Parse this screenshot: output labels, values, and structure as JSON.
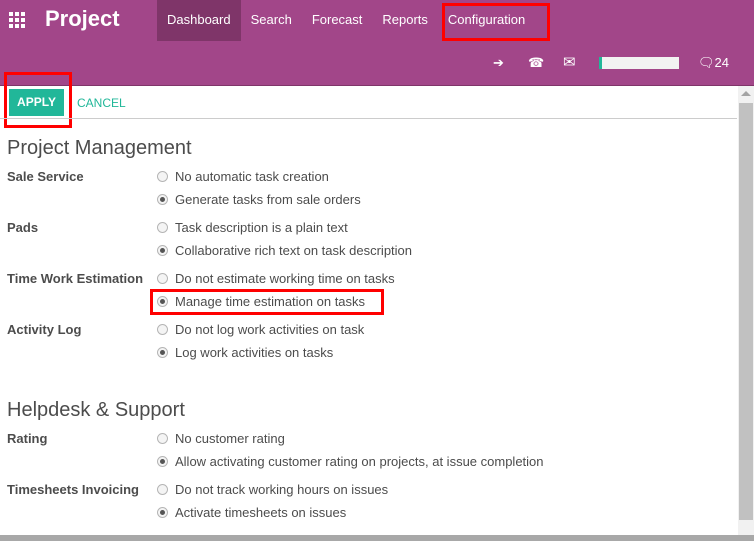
{
  "header": {
    "app_title": "Project",
    "nav": [
      {
        "label": "Dashboard",
        "active": true
      },
      {
        "label": "Search"
      },
      {
        "label": "Forecast"
      },
      {
        "label": "Reports"
      },
      {
        "label": "Configuration"
      }
    ],
    "systray": {
      "icons": [
        "sign-in-icon",
        "phone-icon",
        "envelope-icon",
        "chat-icon"
      ],
      "progress_percent": 4,
      "messages_count": "24"
    },
    "brand_color": "#a24689"
  },
  "actions": {
    "apply": "APPLY",
    "cancel": "CANCEL",
    "accent": "#21b799"
  },
  "sections": [
    {
      "title": "Project Management",
      "settings": [
        {
          "label": "Sale Service",
          "options": [
            {
              "text": "No automatic task creation",
              "selected": false
            },
            {
              "text": "Generate tasks from sale orders",
              "selected": true
            }
          ]
        },
        {
          "label": "Pads",
          "options": [
            {
              "text": "Task description is a plain text",
              "selected": false
            },
            {
              "text": "Collaborative rich text on task description",
              "selected": true
            }
          ]
        },
        {
          "label": "Time Work Estimation",
          "options": [
            {
              "text": "Do not estimate working time on tasks",
              "selected": false
            },
            {
              "text": "Manage time estimation on tasks",
              "selected": true
            }
          ]
        },
        {
          "label": "Activity Log",
          "options": [
            {
              "text": "Do not log work activities on task",
              "selected": false
            },
            {
              "text": "Log work activities on tasks",
              "selected": true
            }
          ]
        }
      ]
    },
    {
      "title": "Helpdesk & Support",
      "settings": [
        {
          "label": "Rating",
          "options": [
            {
              "text": "No customer rating",
              "selected": false
            },
            {
              "text": "Allow activating customer rating on projects, at issue completion",
              "selected": true
            }
          ]
        },
        {
          "label": "Timesheets Invoicing",
          "options": [
            {
              "text": "Do not track working hours on issues",
              "selected": false
            },
            {
              "text": "Activate timesheets on issues",
              "selected": true
            }
          ]
        }
      ]
    }
  ]
}
